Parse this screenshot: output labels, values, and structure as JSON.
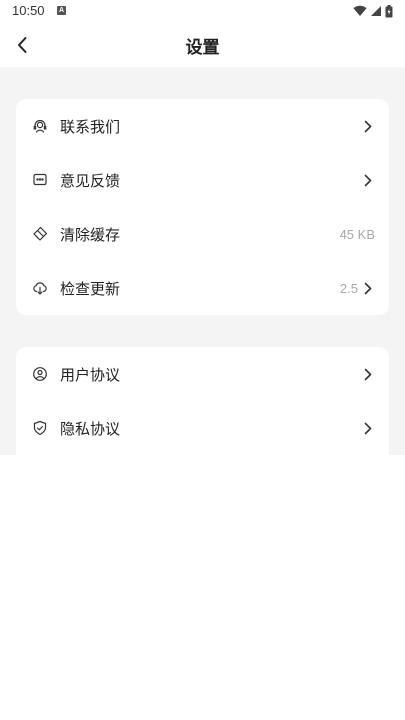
{
  "status_bar": {
    "time": "10:50",
    "notification_badge": "A"
  },
  "header": {
    "title": "设置"
  },
  "groups": [
    {
      "items": [
        {
          "label": "联系我们",
          "icon": "headset-icon",
          "value": "",
          "chevron": true
        },
        {
          "label": "意见反馈",
          "icon": "message-icon",
          "value": "",
          "chevron": true
        },
        {
          "label": "清除缓存",
          "icon": "eraser-icon",
          "value": "45 KB",
          "chevron": false
        },
        {
          "label": "检查更新",
          "icon": "cloud-download-icon",
          "value": "2.5",
          "chevron": true
        }
      ]
    },
    {
      "items": [
        {
          "label": "用户协议",
          "icon": "user-circle-icon",
          "value": "",
          "chevron": true
        },
        {
          "label": "隐私协议",
          "icon": "shield-icon",
          "value": "",
          "chevron": true
        }
      ]
    }
  ]
}
